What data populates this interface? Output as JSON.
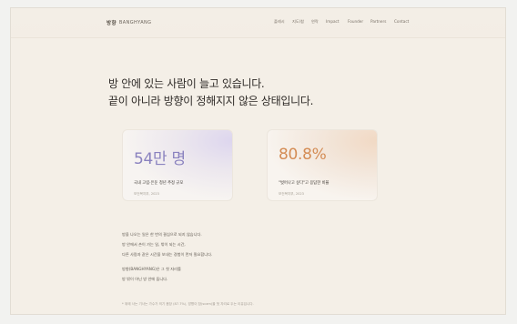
{
  "brand": {
    "ko": "방향",
    "en": "BANGHYANG"
  },
  "nav": [
    "플레시",
    "지도/참",
    "연락",
    "Impact",
    "Founder",
    "Partners",
    "Contact"
  ],
  "hero": {
    "line1": "방 안에 있는 사람이 늘고 있습니다.",
    "line2": "끝이 아니라 방향이 정해지지 않은 상태입니다."
  },
  "stats": [
    {
      "value": "54만 명",
      "caption": "국내 고립·은둔 청년 추정 규모",
      "source": "보건복지부, 2023",
      "accent": "#8a82bf"
    },
    {
      "value": "80.8%",
      "caption": "\"벗어나고 싶다\"고 응답한 비율",
      "source": "보건복지부, 2023",
      "accent": "#d48c54"
    }
  ],
  "body": {
    "p1": [
      "방을 나오는 일은 한 번의 결심으로 되지 않습니다.",
      "방 안에서 손이 가는 일, 밖이 되는 시간,",
      "다른 사람과 같은 시간을 보내는 경험이 먼저 필요합니다."
    ],
    "p2": [
      "방향(BANGHYANG)은 그 첫 자리를",
      "방 밖이 아닌 방 안에 둡니다."
    ]
  },
  "footnote": "* 위에 사는 기사는 가수가 의기 몸장 (87.7%), 방향이 참(scam)을 첫 자리로 두는 이유입니다."
}
